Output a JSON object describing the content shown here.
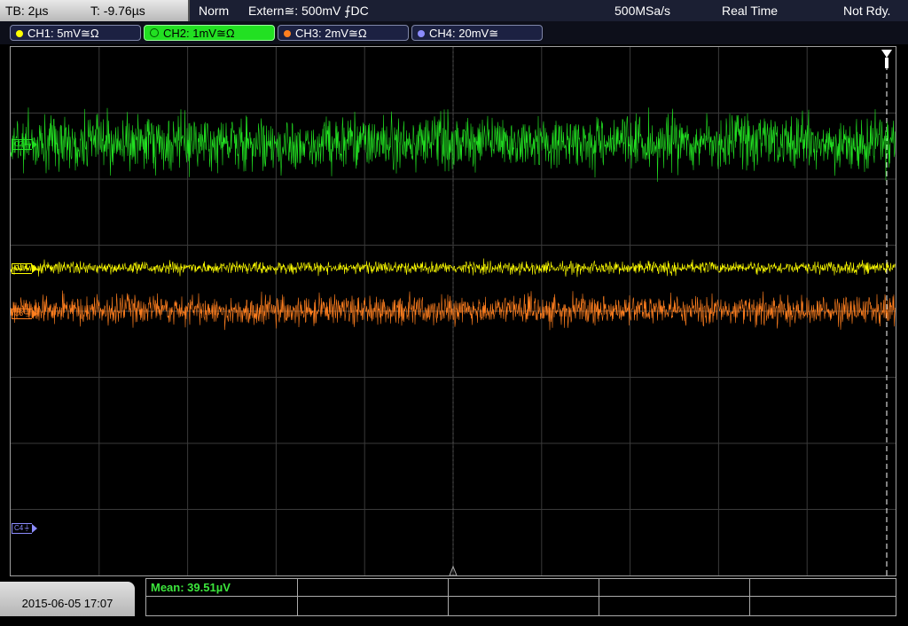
{
  "status": {
    "timebase": "TB: 2µs",
    "trigger_time": "T: -9.76µs",
    "trigger_mode": "Norm",
    "trigger_source": "Extern≅: 500mV ⨍DC",
    "sample_rate": "500MSa/s",
    "acq_mode": "Real Time",
    "ready_state": "Not Rdy."
  },
  "channels": [
    {
      "label": "CH1: 5mV≅Ω",
      "color": "#ffff00",
      "marker": "C1"
    },
    {
      "label": "CH2: 1mV≅Ω",
      "color": "#22e022",
      "marker": "C2"
    },
    {
      "label": "CH3: 2mV≅Ω",
      "color": "#ff7f1f",
      "marker": "C3"
    },
    {
      "label": "CH4: 20mV≅",
      "color": "#8c8cff",
      "marker": "C4"
    }
  ],
  "active_channel": "CH2",
  "datetime": "2015-06-05 17:07",
  "measurement": {
    "mean": "Mean: 39.51µV"
  },
  "colors": {
    "grid": "#3a3a3a",
    "frame": "#a0a0a0"
  }
}
